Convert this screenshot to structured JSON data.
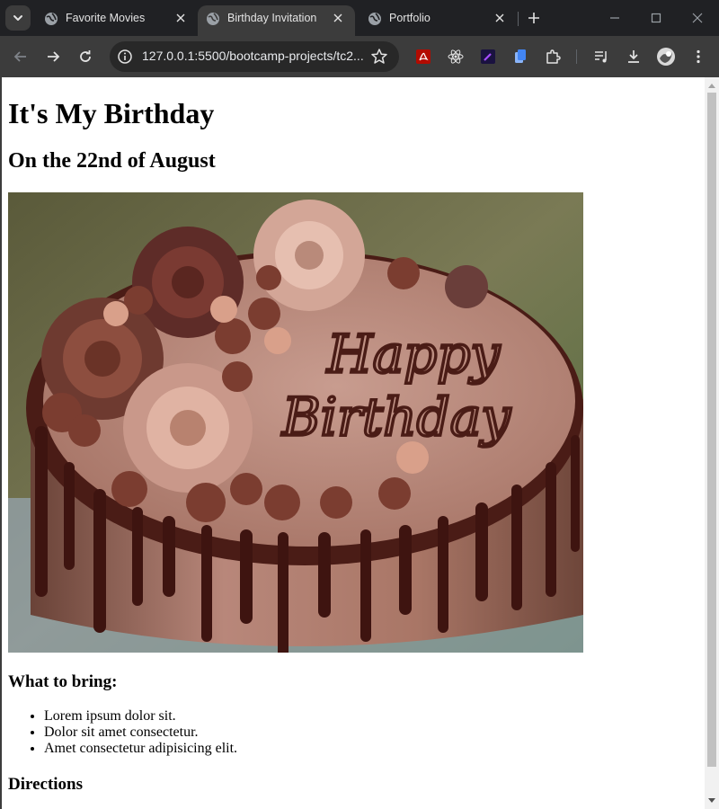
{
  "browser": {
    "tabs": [
      {
        "title": "Favorite Movies",
        "active": false
      },
      {
        "title": "Birthday Invitation",
        "active": true
      },
      {
        "title": "Portfolio",
        "active": false
      }
    ],
    "url": "127.0.0.1:5500/bootcamp-projects/tc2..."
  },
  "page": {
    "heading": "It's My Birthday",
    "subheading": "On the 22nd of August",
    "image": {
      "cake_text_line1": "Happy",
      "cake_text_line2": "Birthday"
    },
    "bring_heading": "What to bring:",
    "bring_items": [
      "Lorem ipsum dolor sit.",
      "Dolor sit amet consectetur.",
      "Amet consectetur adipisicing elit."
    ],
    "directions_heading": "Directions"
  },
  "colors": {
    "tabstrip_bg": "#202124",
    "toolbar_bg": "#3c3c3c",
    "omnibox_bg": "#282828",
    "page_bg": "#ffffff"
  }
}
